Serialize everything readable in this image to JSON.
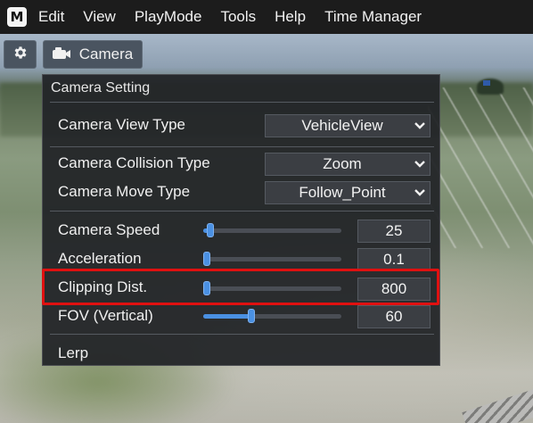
{
  "menubar": {
    "logo": "M",
    "items": [
      "Edit",
      "View",
      "PlayMode",
      "Tools",
      "Help",
      "Time Manager"
    ]
  },
  "toolbar": {
    "settings_icon": "gear-icon",
    "camera_label": "Camera",
    "camera_icon": "camera-icon"
  },
  "panel": {
    "title": "Camera Setting",
    "view_type": {
      "label": "Camera View Type",
      "value": "VehicleView"
    },
    "collision_type": {
      "label": "Camera Collision Type",
      "value": "Zoom"
    },
    "move_type": {
      "label": "Camera Move Type",
      "value": "Follow_Point"
    },
    "speed": {
      "label": "Camera Speed",
      "value": "25",
      "slider_fraction": 0.05
    },
    "acceleration": {
      "label": "Acceleration",
      "value": "0.1",
      "slider_fraction": 0.0
    },
    "clipping": {
      "label": "Clipping Dist.",
      "value": "800",
      "slider_fraction": 0.0
    },
    "fov": {
      "label": "FOV (Vertical)",
      "value": "60",
      "slider_fraction": 0.35
    },
    "lerp": {
      "label": "Lerp"
    }
  },
  "colors": {
    "accent": "#4a90e2",
    "highlight": "#e01010",
    "panel_bg": "#222427"
  }
}
